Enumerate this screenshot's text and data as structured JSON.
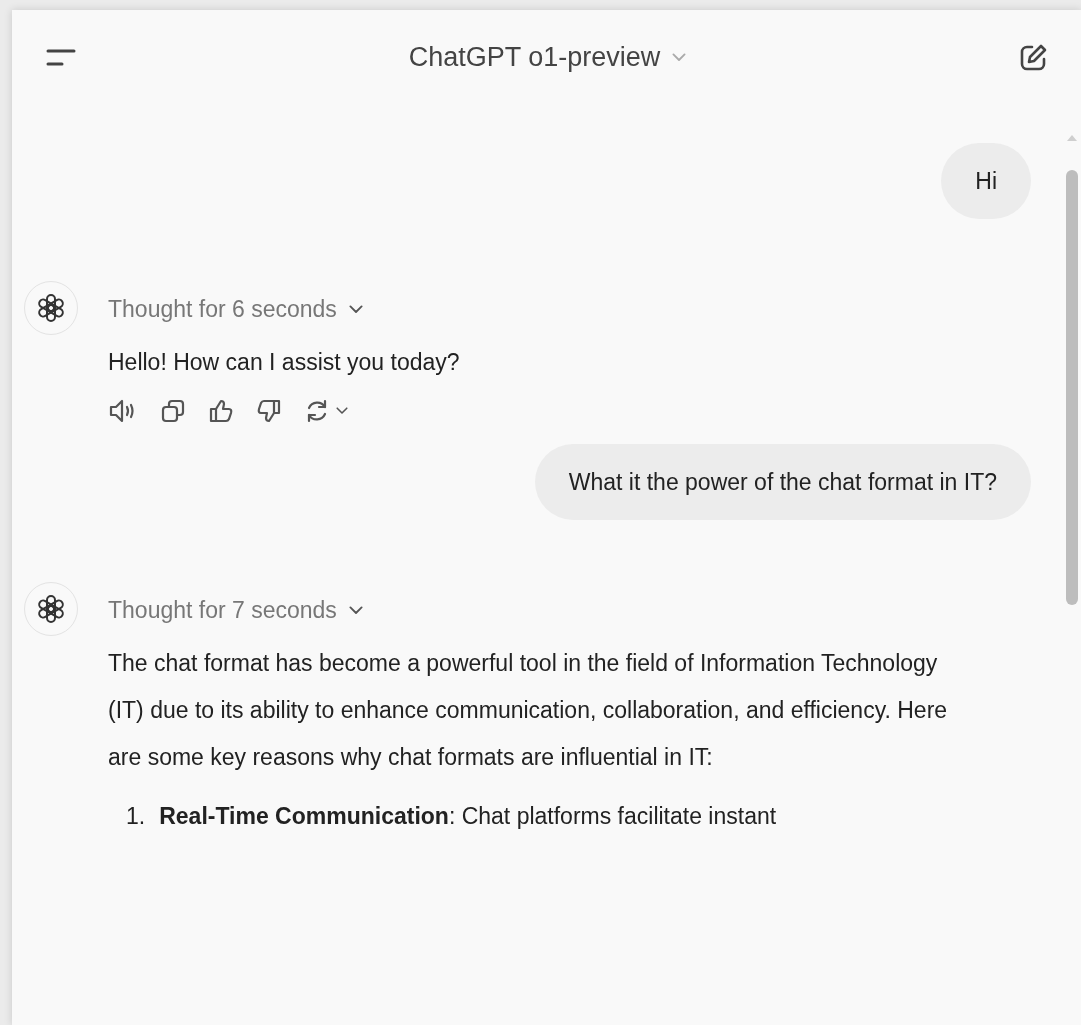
{
  "header": {
    "title": "ChatGPT o1-preview"
  },
  "messages": [
    {
      "kind": "user",
      "text": "Hi"
    },
    {
      "kind": "assistant",
      "thought": "Thought for 6 seconds",
      "paragraphs": [
        "Hello! How can I assist you today?"
      ],
      "actions": true
    },
    {
      "kind": "user",
      "text": "What it the power of the chat format in IT?"
    },
    {
      "kind": "assistant",
      "thought": "Thought for 7 seconds",
      "paragraphs": [
        "The chat format has become a powerful tool in the field of Information Technology (IT) due to its ability to enhance communication, collaboration, and efficiency. Here are some key reasons why chat formats are influential in IT:"
      ],
      "list": [
        {
          "number": "1.",
          "text": "**Real-Time Communication**: Chat platforms facilitate instant"
        }
      ]
    }
  ]
}
